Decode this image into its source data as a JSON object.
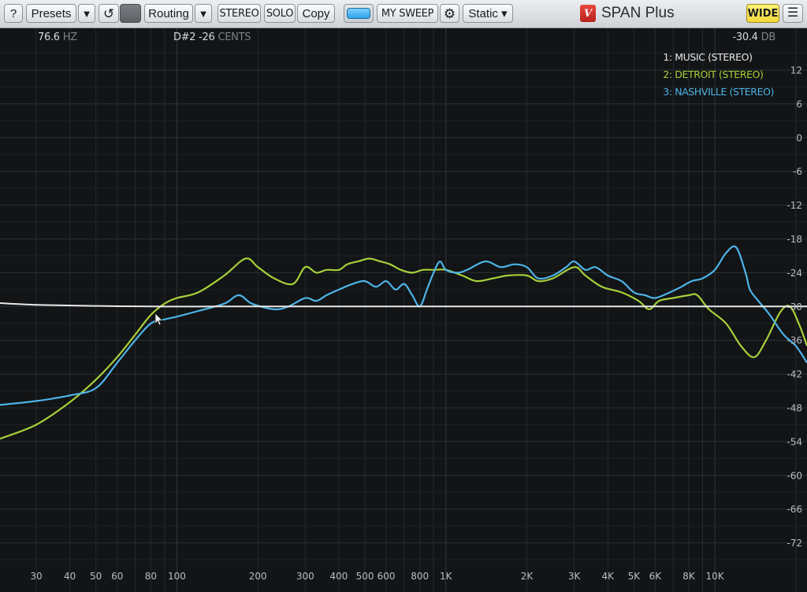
{
  "toolbar": {
    "help_label": "?",
    "presets_label": "Presets",
    "presets_dropdown_icon": "▼",
    "reset_icon": "↺",
    "routing_label": "Routing",
    "routing_dropdown_icon": "▼",
    "stereo_label": "STEREO",
    "solo_label": "SOLO",
    "copy_label": "Copy",
    "sweep_label": "MY SWEEP",
    "settings_icon": "⚙",
    "mode_label": "Static ▾",
    "app_name": "SPAN Plus",
    "wide_label": "WIDE",
    "menu_icon": "☰"
  },
  "readouts": {
    "frequency_value": "76.6",
    "frequency_unit": "HZ",
    "note_value": "D#2 -26",
    "note_unit": "CENTS",
    "level_value": "-30.4",
    "level_unit": "DB"
  },
  "colors": {
    "background": "#121416",
    "grid": "#262a2d",
    "music": "#e8e8e8",
    "detroit": "#a6d03a",
    "nashville": "#4db3e6"
  },
  "chart_data": {
    "type": "line",
    "x_scale": "log",
    "xlim": [
      22,
      22000
    ],
    "ylim": [
      -76,
      18
    ],
    "grid": true,
    "legend_position": "top-right",
    "x_tick_labels": [
      {
        "f": 30,
        "label": "30"
      },
      {
        "f": 40,
        "label": "40"
      },
      {
        "f": 50,
        "label": "50"
      },
      {
        "f": 60,
        "label": "60"
      },
      {
        "f": 80,
        "label": "80"
      },
      {
        "f": 100,
        "label": "100"
      },
      {
        "f": 200,
        "label": "200"
      },
      {
        "f": 300,
        "label": "300"
      },
      {
        "f": 400,
        "label": "400"
      },
      {
        "f": 500,
        "label": "500"
      },
      {
        "f": 600,
        "label": "600"
      },
      {
        "f": 800,
        "label": "800"
      },
      {
        "f": 1000,
        "label": "1K"
      },
      {
        "f": 2000,
        "label": "2K"
      },
      {
        "f": 3000,
        "label": "3K"
      },
      {
        "f": 4000,
        "label": "4K"
      },
      {
        "f": 5000,
        "label": "5K"
      },
      {
        "f": 6000,
        "label": "6K"
      },
      {
        "f": 8000,
        "label": "8K"
      },
      {
        "f": 10000,
        "label": "10K"
      }
    ],
    "y_tick_labels": [
      "12",
      "6",
      "0",
      "-6",
      "-12",
      "-18",
      "-24",
      "-30",
      "-36",
      "-42",
      "-48",
      "-54",
      "-60",
      "-66",
      "-72"
    ],
    "y_ticks": [
      12,
      6,
      0,
      -6,
      -12,
      -18,
      -24,
      -30,
      -36,
      -42,
      -48,
      -54,
      -60,
      -66,
      -72
    ],
    "series": [
      {
        "name": "1: MUSIC (STEREO)",
        "color": "#e8e8e8",
        "points": [
          [
            22,
            -29.4
          ],
          [
            30,
            -29.7
          ],
          [
            50,
            -29.9
          ],
          [
            80,
            -30.0
          ],
          [
            150,
            -30.0
          ],
          [
            500,
            -30.0
          ],
          [
            1000,
            -30.0
          ],
          [
            3000,
            -30.0
          ],
          [
            6000,
            -30.0
          ],
          [
            10000,
            -30.0
          ],
          [
            16000,
            -30.0
          ],
          [
            22000,
            -30.0
          ]
        ]
      },
      {
        "name": "2: DETROIT (STEREO)",
        "color": "#a6d03a",
        "points": [
          [
            22,
            -53.5
          ],
          [
            30,
            -51
          ],
          [
            40,
            -47
          ],
          [
            50,
            -43
          ],
          [
            60,
            -39
          ],
          [
            70,
            -35
          ],
          [
            80,
            -31.5
          ],
          [
            90,
            -29.5
          ],
          [
            100,
            -28.5
          ],
          [
            120,
            -27.5
          ],
          [
            150,
            -24.5
          ],
          [
            180,
            -21.5
          ],
          [
            200,
            -23
          ],
          [
            230,
            -25
          ],
          [
            270,
            -26
          ],
          [
            300,
            -23
          ],
          [
            330,
            -24
          ],
          [
            360,
            -23.5
          ],
          [
            400,
            -23.5
          ],
          [
            430,
            -22.5
          ],
          [
            470,
            -22
          ],
          [
            520,
            -21.5
          ],
          [
            570,
            -22
          ],
          [
            620,
            -22.5
          ],
          [
            680,
            -23.5
          ],
          [
            750,
            -24
          ],
          [
            820,
            -23.5
          ],
          [
            900,
            -23.5
          ],
          [
            1000,
            -23.5
          ],
          [
            1150,
            -24.5
          ],
          [
            1300,
            -25.5
          ],
          [
            1500,
            -25
          ],
          [
            1700,
            -24.5
          ],
          [
            2000,
            -24.5
          ],
          [
            2200,
            -25.5
          ],
          [
            2500,
            -25
          ],
          [
            3000,
            -23
          ],
          [
            3300,
            -24.5
          ],
          [
            3800,
            -26.5
          ],
          [
            4500,
            -27.5
          ],
          [
            5200,
            -29
          ],
          [
            5700,
            -30.5
          ],
          [
            6200,
            -29
          ],
          [
            7000,
            -28.5
          ],
          [
            8000,
            -28
          ],
          [
            8600,
            -28
          ],
          [
            9500,
            -30.5
          ],
          [
            11000,
            -33
          ],
          [
            12500,
            -37
          ],
          [
            14000,
            -39
          ],
          [
            15500,
            -36
          ],
          [
            17500,
            -31
          ],
          [
            19000,
            -30
          ],
          [
            20500,
            -33
          ],
          [
            22000,
            -37
          ]
        ]
      },
      {
        "name": "3: NASHVILLE (STEREO)",
        "color": "#4db3e6",
        "points": [
          [
            22,
            -47.5
          ],
          [
            30,
            -46.8
          ],
          [
            40,
            -45.8
          ],
          [
            50,
            -44.5
          ],
          [
            60,
            -40
          ],
          [
            70,
            -36
          ],
          [
            80,
            -33
          ],
          [
            90,
            -32.3
          ],
          [
            100,
            -31.8
          ],
          [
            120,
            -30.8
          ],
          [
            150,
            -29.5
          ],
          [
            170,
            -28
          ],
          [
            190,
            -29.5
          ],
          [
            230,
            -30.5
          ],
          [
            260,
            -30
          ],
          [
            300,
            -28.5
          ],
          [
            330,
            -29
          ],
          [
            360,
            -28
          ],
          [
            400,
            -27
          ],
          [
            450,
            -26
          ],
          [
            500,
            -25.5
          ],
          [
            550,
            -26.5
          ],
          [
            600,
            -25.5
          ],
          [
            650,
            -27
          ],
          [
            700,
            -26
          ],
          [
            750,
            -28
          ],
          [
            800,
            -30
          ],
          [
            850,
            -27
          ],
          [
            900,
            -24
          ],
          [
            950,
            -22
          ],
          [
            1000,
            -23.5
          ],
          [
            1100,
            -24
          ],
          [
            1200,
            -23.5
          ],
          [
            1400,
            -22
          ],
          [
            1600,
            -23
          ],
          [
            1800,
            -22.5
          ],
          [
            2000,
            -23
          ],
          [
            2200,
            -25
          ],
          [
            2500,
            -24.5
          ],
          [
            2800,
            -23
          ],
          [
            3000,
            -22
          ],
          [
            3300,
            -23.5
          ],
          [
            3600,
            -23
          ],
          [
            4000,
            -24.5
          ],
          [
            4500,
            -25.5
          ],
          [
            5000,
            -27.5
          ],
          [
            5500,
            -28
          ],
          [
            6000,
            -28.5
          ],
          [
            6800,
            -27.5
          ],
          [
            7500,
            -26.5
          ],
          [
            8200,
            -25.5
          ],
          [
            9000,
            -25
          ],
          [
            10000,
            -23.5
          ],
          [
            11000,
            -20.5
          ],
          [
            12000,
            -19.5
          ],
          [
            13000,
            -24
          ],
          [
            13500,
            -27
          ],
          [
            14500,
            -29
          ],
          [
            16000,
            -31.5
          ],
          [
            18000,
            -35
          ],
          [
            20000,
            -37
          ],
          [
            22000,
            -40
          ]
        ]
      }
    ]
  }
}
